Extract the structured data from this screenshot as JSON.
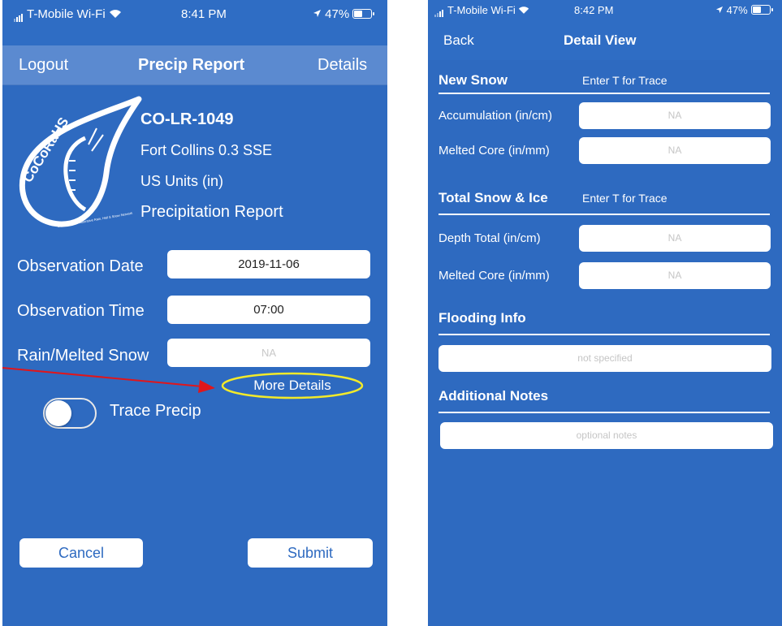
{
  "screen1": {
    "status": {
      "carrier": "T-Mobile Wi-Fi",
      "time": "8:41 PM",
      "battery": "47%"
    },
    "nav": {
      "left": "Logout",
      "title": "Precip Report",
      "right": "Details"
    },
    "logo": {
      "name": "CoCoRaHS",
      "tagline": "Community Collaborative Rain, Hail & Snow Network"
    },
    "station": {
      "id": "CO-LR-1049",
      "location": "Fort Collins 0.3 SSE",
      "units": "US Units (in)",
      "report": "Precipitation Report"
    },
    "form": {
      "obs_date_label": "Observation Date",
      "obs_date_value": "2019-11-06",
      "obs_time_label": "Observation Time",
      "obs_time_value": "07:00",
      "rain_label": "Rain/Melted Snow",
      "rain_placeholder": "NA"
    },
    "more_details": "More Details",
    "trace_label": "Trace Precip",
    "trace_on": false,
    "cancel": "Cancel",
    "submit": "Submit"
  },
  "screen2": {
    "status": {
      "carrier": "T-Mobile Wi-Fi",
      "time": "8:42 PM",
      "battery": "47%"
    },
    "nav": {
      "left": "Back",
      "title": "Detail View"
    },
    "new_snow": {
      "title": "New Snow",
      "hint": "Enter T for Trace",
      "accum_label": "Accumulation (in/cm)",
      "accum_placeholder": "NA",
      "melted_label": "Melted Core (in/mm)",
      "melted_placeholder": "NA"
    },
    "total_snow": {
      "title": "Total Snow & Ice",
      "hint": "Enter T for Trace",
      "depth_label": "Depth Total (in/cm)",
      "depth_placeholder": "NA",
      "melted_label": "Melted Core (in/mm)",
      "melted_placeholder": "NA"
    },
    "flooding": {
      "title": "Flooding Info",
      "placeholder": "not specified"
    },
    "notes": {
      "title": "Additional Notes",
      "placeholder": "optional notes"
    }
  },
  "colors": {
    "background": "#2e6ac0",
    "nav_bar": "#5b8ad0",
    "annotation_arrow": "#e0161b",
    "annotation_ellipse": "#f2ea2a"
  }
}
